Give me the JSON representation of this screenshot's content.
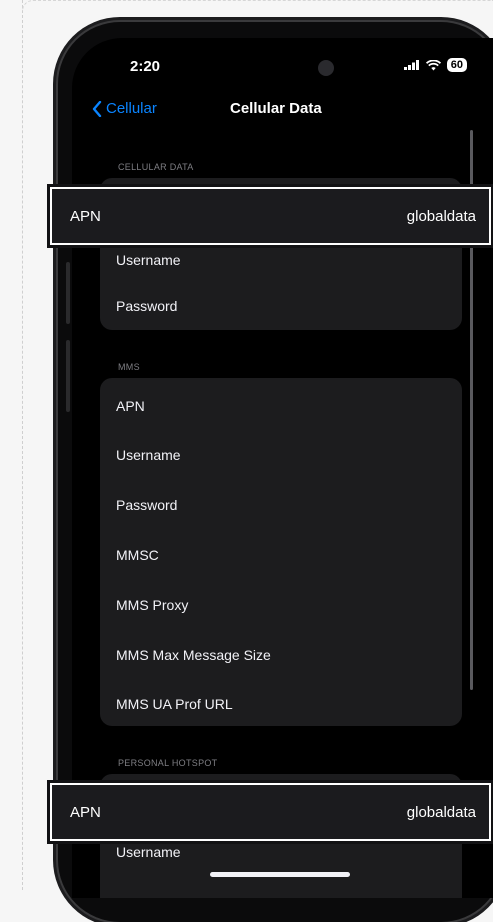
{
  "status_bar": {
    "time": "2:20",
    "battery": "60"
  },
  "nav": {
    "back_label": "Cellular",
    "title": "Cellular Data"
  },
  "cellular_data": {
    "header": "CELLULAR DATA",
    "rows": [
      "Username",
      "Password"
    ]
  },
  "mms": {
    "header": "MMS",
    "rows": [
      "APN",
      "Username",
      "Password",
      "MMSC",
      "MMS Proxy",
      "MMS Max Message Size",
      "MMS UA Prof URL"
    ]
  },
  "personal_hotspot": {
    "header": "PERSONAL HOTSPOT",
    "rows": [
      "Username"
    ]
  },
  "callouts": [
    {
      "label": "APN",
      "value": "globaldata"
    },
    {
      "label": "APN",
      "value": "globaldata"
    }
  ],
  "colors": {
    "accent": "#0a84ff",
    "background": "#000000",
    "cell": "#1c1c1e"
  }
}
